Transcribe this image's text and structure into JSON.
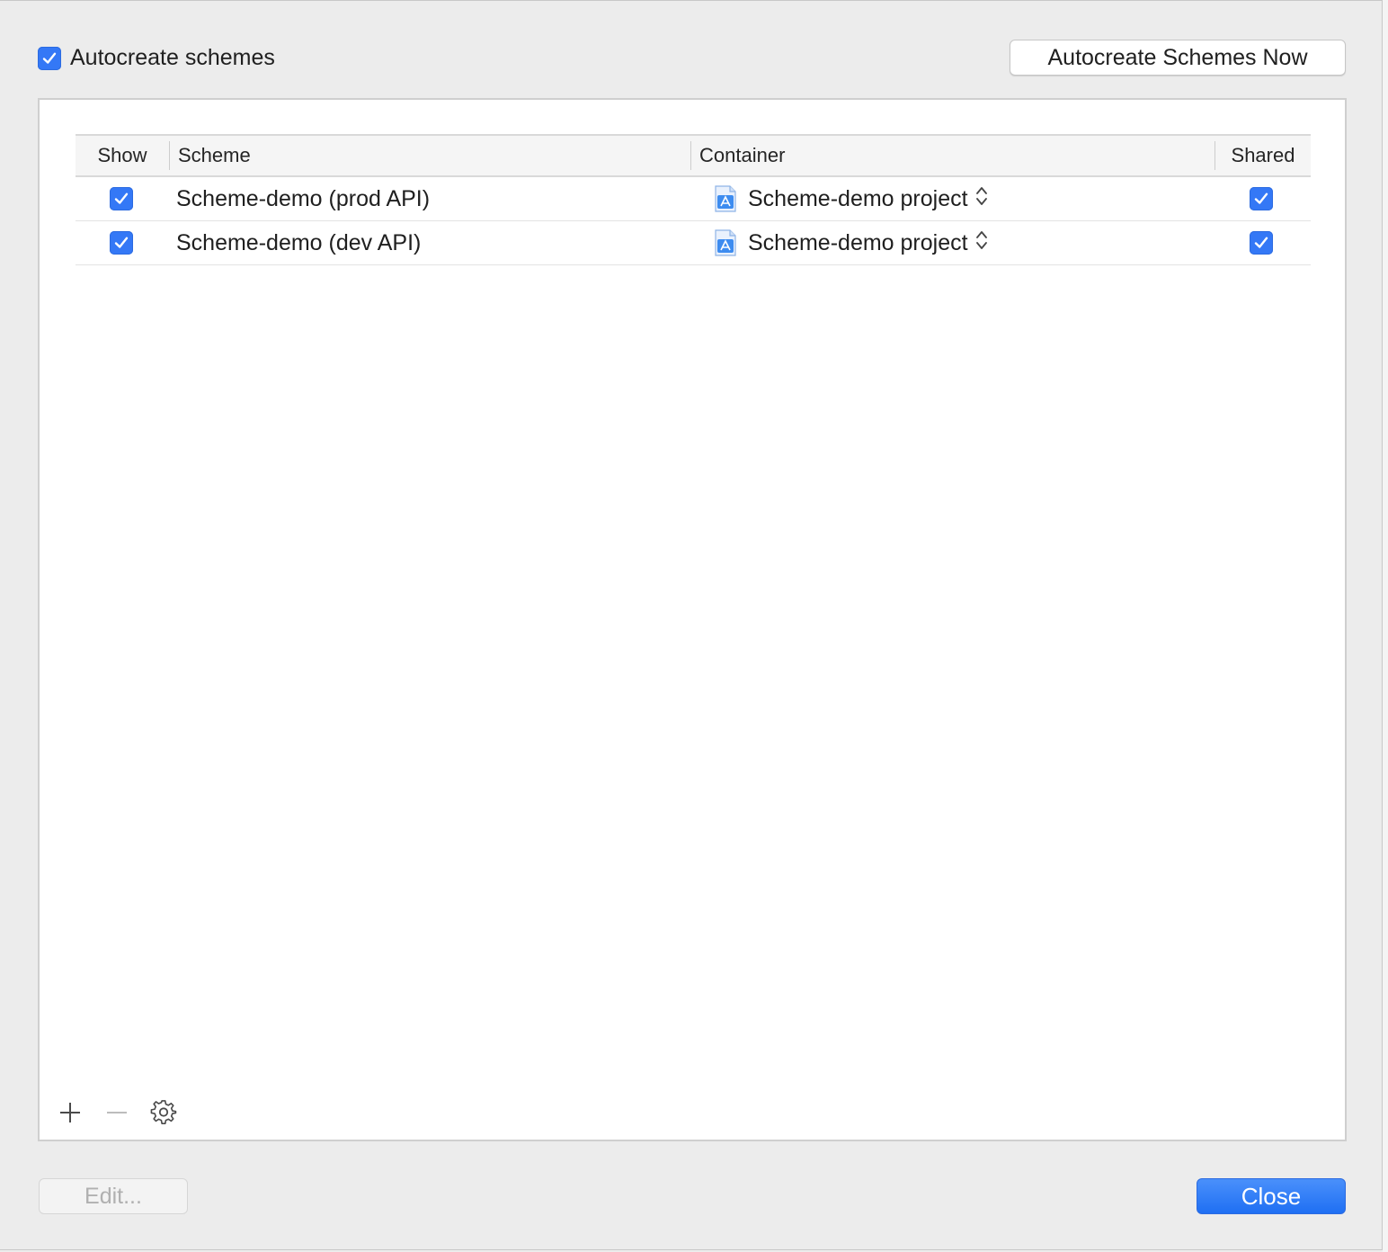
{
  "autocreate": {
    "label": "Autocreate schemes",
    "checked": true
  },
  "toolbar": {
    "autocreate_now_label": "Autocreate Schemes Now"
  },
  "table": {
    "columns": {
      "show": "Show",
      "scheme": "Scheme",
      "container": "Container",
      "shared": "Shared"
    },
    "rows": [
      {
        "show": true,
        "scheme": "Scheme-demo (prod API)",
        "container": "Scheme-demo project",
        "shared": true
      },
      {
        "show": true,
        "scheme": "Scheme-demo (dev API)",
        "container": "Scheme-demo project",
        "shared": true
      }
    ]
  },
  "footer": {
    "edit_label": "Edit...",
    "close_label": "Close"
  },
  "icons": {
    "container": "xcode-project-icon",
    "add": "plus-icon",
    "remove": "minus-icon",
    "settings": "gear-icon"
  },
  "colors": {
    "accent": "#3478f6",
    "close_button": "#1f6ff3"
  }
}
